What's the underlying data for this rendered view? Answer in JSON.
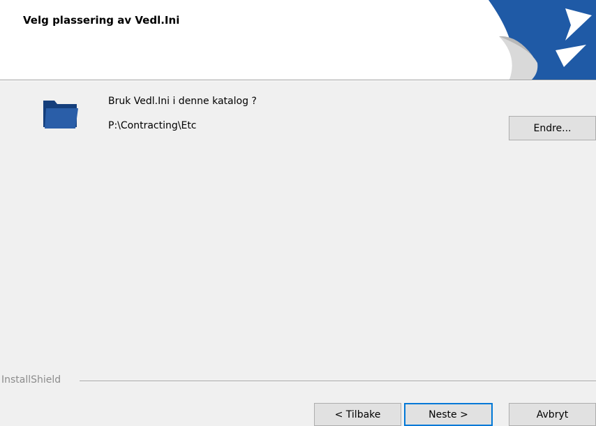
{
  "header": {
    "title": "Velg plassering av Vedl.Ini",
    "logo_icon": "installshield-logo-icon",
    "accent_color": "#1f5aa6"
  },
  "main": {
    "folder_icon": "folder-icon",
    "prompt": "Bruk Vedl.Ini i denne katalog ?",
    "path": "P:\\Contracting\\Etc",
    "change_button": "Endre..."
  },
  "footer": {
    "brand": "InstallShield",
    "back_button": "< Tilbake",
    "next_button": "Neste >",
    "cancel_button": "Avbryt"
  }
}
